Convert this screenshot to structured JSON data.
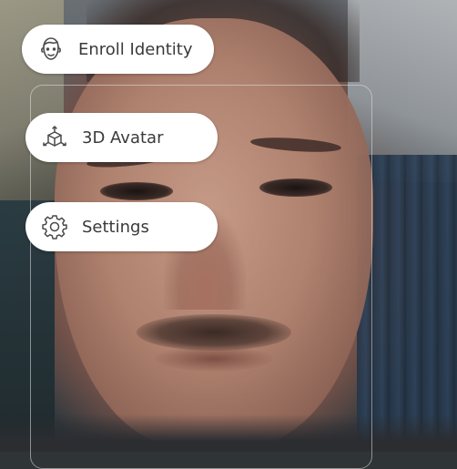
{
  "camera": {
    "icon": "camera-feed"
  },
  "menu": {
    "items": [
      {
        "label": "Enroll Identity",
        "icon": "face-icon"
      },
      {
        "label": "3D Avatar",
        "icon": "cube-icon"
      },
      {
        "label": "Settings",
        "icon": "gear-icon"
      }
    ]
  },
  "colors": {
    "pill_bg": "#ffffff",
    "text": "#3a3a3a",
    "icon_stroke": "#4a4a4a",
    "guide_frame": "#e1e1e1"
  }
}
